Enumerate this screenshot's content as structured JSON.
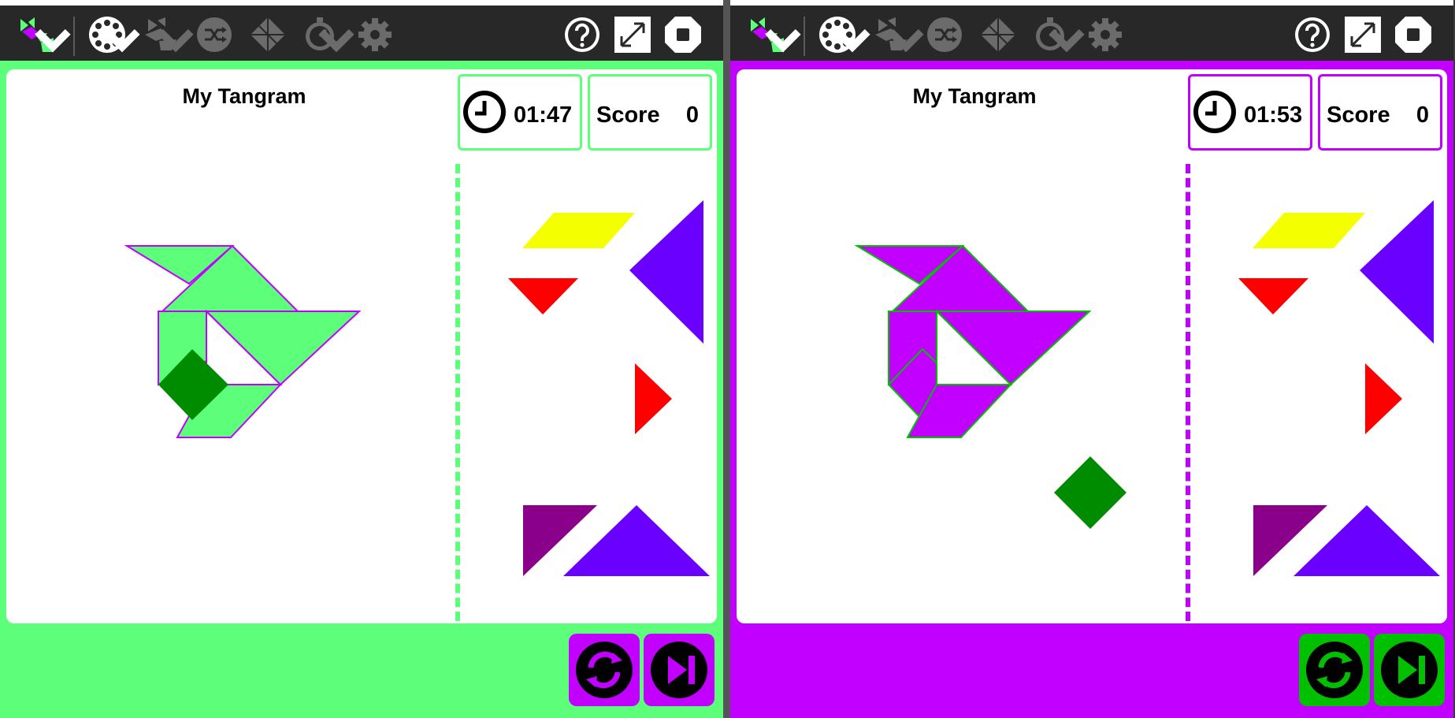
{
  "toolbar": {
    "icons": [
      "tangram-logo-icon",
      "sample-menu-icon",
      "shape-icon",
      "shuffle-icon",
      "pattern-icon",
      "timer-icon",
      "settings-icon",
      "help-icon",
      "fullscreen-icon",
      "stop-icon"
    ]
  },
  "colors": {
    "player1": "#5dff7a",
    "player2": "#c100ff",
    "toolbar": "#282828",
    "yellow": "#f4ff00",
    "red": "#ff0000",
    "blue": "#6a00ff",
    "purple": "#8b008b",
    "green": "#008c00"
  },
  "players": [
    {
      "title": "My Tangram",
      "time": "01:47",
      "score_label": "Score",
      "score": "0"
    },
    {
      "title": "My Tangram",
      "time": "01:53",
      "score_label": "Score",
      "score": "0"
    }
  ],
  "buttons": {
    "refresh": "refresh-icon",
    "skip": "skip-icon"
  }
}
